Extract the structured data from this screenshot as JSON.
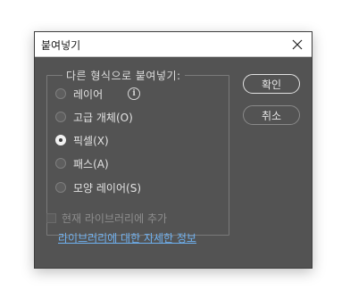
{
  "dialog": {
    "title": "붙여넣기",
    "close_icon": "close-icon"
  },
  "paste_as": {
    "legend": "다른 형식으로 붙여넣기:",
    "options": [
      {
        "label": "레이어",
        "checked": false
      },
      {
        "label": "고급 개체(O)",
        "checked": false
      },
      {
        "label": "픽셀(X)",
        "checked": true
      },
      {
        "label": "패스(A)",
        "checked": false
      },
      {
        "label": "모양 레이어(S)",
        "checked": false
      }
    ],
    "info_icon": "info-icon"
  },
  "buttons": {
    "ok": "확인",
    "cancel": "취소"
  },
  "library": {
    "add_label": "현재 라이브러리에 추가",
    "add_checked": false,
    "link_text": "라이브러리에 대한 자세한 정보"
  }
}
